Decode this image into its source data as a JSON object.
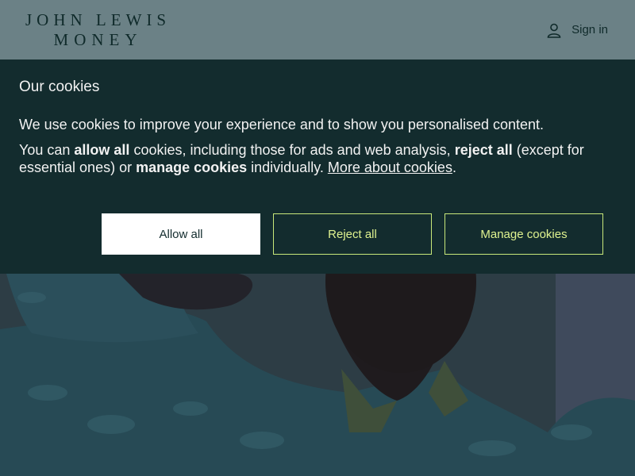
{
  "header": {
    "logo_line1": "JOHN LEWIS",
    "logo_line2": "MONEY",
    "signin_label": "Sign in",
    "signin_icon": "user-icon"
  },
  "cookies": {
    "title": "Our cookies",
    "intro": "We use cookies to improve your experience and to show you personalised content.",
    "body_part1": "You can ",
    "body_bold1": "allow all",
    "body_part2": " cookies, including those for ads and web analysis, ",
    "body_bold2": "reject all",
    "body_part3": " (except for essential ones) or ",
    "body_bold3": "manage cookies",
    "body_part4": " individually. ",
    "link_label": "More about cookies",
    "body_end": ".",
    "buttons": {
      "allow_all": "Allow all",
      "reject_all": "Reject all",
      "manage": "Manage cookies"
    }
  },
  "colors": {
    "header_bg": "#6b8186",
    "banner_bg": "#132c2e",
    "accent_outline": "#c8e87a",
    "accent_text": "#dff28f"
  }
}
